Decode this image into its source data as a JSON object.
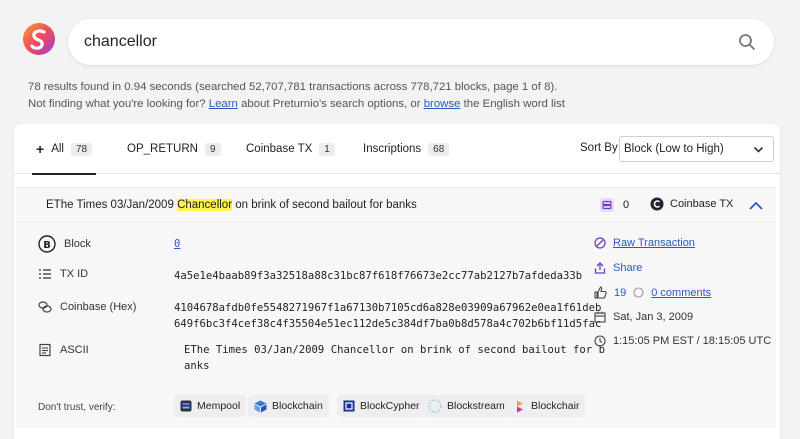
{
  "search": {
    "query": "chancellor"
  },
  "info": {
    "results_line": "78 results found in 0.94 seconds (searched 52,707,781 transactions across 778,721 blocks, page 1 of 8).",
    "help_prefix": "Not finding what you're looking for?",
    "learn_link": "Learn",
    "help_middle": "about Preturnio's search options, or",
    "browse_link": "browse",
    "help_suffix": "the English word list"
  },
  "tabs": [
    {
      "label": "All",
      "count": "78"
    },
    {
      "label": "OP_RETURN",
      "count": "9"
    },
    {
      "label": "Coinbase TX",
      "count": "1"
    },
    {
      "label": "Inscriptions",
      "count": "68"
    }
  ],
  "sort": {
    "label": "Sort By",
    "value": "Block (Low to High)"
  },
  "result": {
    "title_before": "EThe Times 03/Jan/2009",
    "title_highlight": "Chancellor",
    "title_after": "on brink of second bailout for banks",
    "input_count": "0",
    "tag": "Coinbase TX",
    "block_label": "Block",
    "block_value": "0",
    "txid_label": "TX ID",
    "txid_value": "4a5e1e4baab89f3a32518a88c31bc87f618f76673e2cc77ab2127b7afdeda33b",
    "coinbase_label": "Coinbase (Hex)",
    "coinbase_line1": "4104678afdb0fe5548271967f1a67130b7105cd6a828e03909a67962e0ea1f61deb",
    "coinbase_line2": "649f6bc3f4cef38c4f35504e51ec112de5c384df7ba0b8d578a4c702b6bf11d5fac",
    "ascii_label": "ASCII",
    "ascii_line1": "EThe Times 03/Jan/2009 Chancellor on brink of second bailout for b",
    "ascii_line2": "anks",
    "raw_tx": "Raw Transaction",
    "share": "Share",
    "likes": "19",
    "comments": "0 comments",
    "date": "Sat, Jan 3, 2009",
    "time": "1:15:05 PM EST / 18:15:05 UTC",
    "verify_label": "Don't trust, verify:",
    "explorers": [
      "Mempool",
      "Blockchain",
      "BlockCypher",
      "Blockstream",
      "Blockchair"
    ]
  },
  "colors": {
    "link": "#2c57c8",
    "highlight": "#fdf34a",
    "background": "#f3f3f4"
  }
}
